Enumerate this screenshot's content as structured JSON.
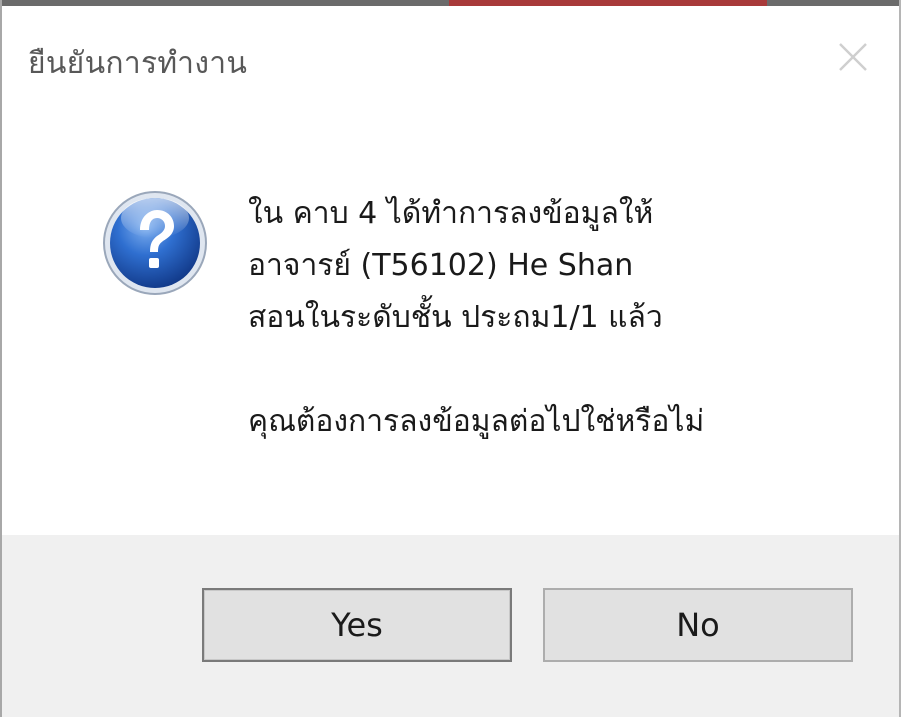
{
  "dialog": {
    "title": "ยืนยันการทำงาน",
    "close_icon": "close-icon",
    "icon": "question-icon",
    "message_lines": [
      "ใน คาบ 4 ได้ทำการลงข้อมูลให้",
      "อาจารย์ (T56102) He Shan",
      "สอนในระดับชั้น ประถม1/1   แล้ว"
    ],
    "question": "คุณต้องการลงข้อมูลต่อไปใช่หรือไม่",
    "buttons": {
      "yes_label": "Yes",
      "no_label": "No"
    }
  },
  "colors": {
    "footer_bg": "#f0f0f0",
    "icon_blue": "#1f56b8",
    "button_bg": "#e1e1e1"
  }
}
